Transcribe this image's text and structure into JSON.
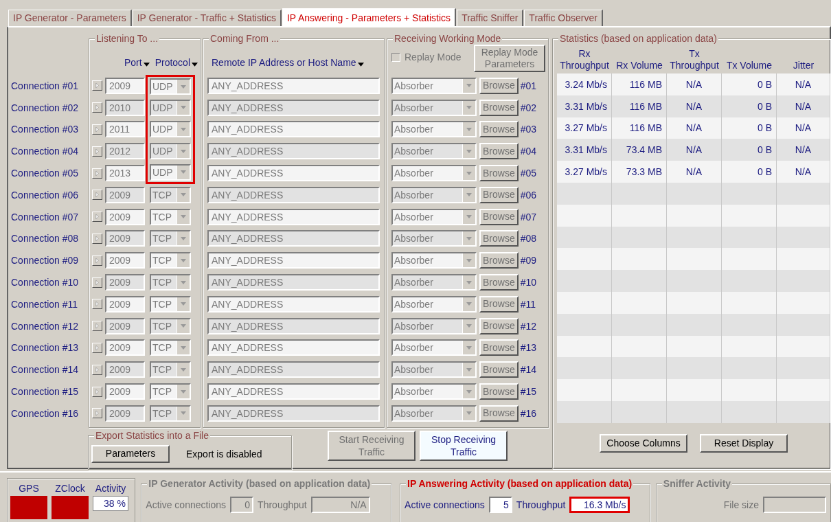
{
  "tabs": [
    {
      "label": "IP Generator - Parameters",
      "selected": false
    },
    {
      "label": "IP Generator - Traffic + Statistics",
      "selected": false
    },
    {
      "label": "IP Answering - Parameters + Statistics",
      "selected": true
    },
    {
      "label": "Traffic Sniffer",
      "selected": false
    },
    {
      "label": "Traffic Observer",
      "selected": false
    }
  ],
  "listening": {
    "legend": "Listening To ...",
    "port_header": "Port",
    "protocol_header": "Protocol"
  },
  "coming_from": {
    "legend": "Coming From ...",
    "header": "Remote IP Address or Host Name"
  },
  "receiving": {
    "legend": "Receiving Working Mode",
    "replay_mode": {
      "label": "Replay Mode",
      "checked": false
    },
    "replay_button": "Replay Mode Parameters"
  },
  "connections": [
    {
      "label": "Connection #01",
      "port": "2009",
      "protocol": "UDP",
      "address": "ANY_ADDRESS",
      "mode": "Absorber",
      "browse": "Browse",
      "index": "#01",
      "highlighted": true
    },
    {
      "label": "Connection #02",
      "port": "2010",
      "protocol": "UDP",
      "address": "ANY_ADDRESS",
      "mode": "Absorber",
      "browse": "Browse",
      "index": "#02",
      "highlighted": true
    },
    {
      "label": "Connection #03",
      "port": "2011",
      "protocol": "UDP",
      "address": "ANY_ADDRESS",
      "mode": "Absorber",
      "browse": "Browse",
      "index": "#03",
      "highlighted": true
    },
    {
      "label": "Connection #04",
      "port": "2012",
      "protocol": "UDP",
      "address": "ANY_ADDRESS",
      "mode": "Absorber",
      "browse": "Browse",
      "index": "#04",
      "highlighted": true
    },
    {
      "label": "Connection #05",
      "port": "2013",
      "protocol": "UDP",
      "address": "ANY_ADDRESS",
      "mode": "Absorber",
      "browse": "Browse",
      "index": "#05",
      "highlighted": true
    },
    {
      "label": "Connection #06",
      "port": "2009",
      "protocol": "TCP",
      "address": "ANY_ADDRESS",
      "mode": "Absorber",
      "browse": "Browse",
      "index": "#06",
      "highlighted": false
    },
    {
      "label": "Connection #07",
      "port": "2009",
      "protocol": "TCP",
      "address": "ANY_ADDRESS",
      "mode": "Absorber",
      "browse": "Browse",
      "index": "#07",
      "highlighted": false
    },
    {
      "label": "Connection #08",
      "port": "2009",
      "protocol": "TCP",
      "address": "ANY_ADDRESS",
      "mode": "Absorber",
      "browse": "Browse",
      "index": "#08",
      "highlighted": false
    },
    {
      "label": "Connection #09",
      "port": "2009",
      "protocol": "TCP",
      "address": "ANY_ADDRESS",
      "mode": "Absorber",
      "browse": "Browse",
      "index": "#09",
      "highlighted": false
    },
    {
      "label": "Connection #10",
      "port": "2009",
      "protocol": "TCP",
      "address": "ANY_ADDRESS",
      "mode": "Absorber",
      "browse": "Browse",
      "index": "#10",
      "highlighted": false
    },
    {
      "label": "Connection #11",
      "port": "2009",
      "protocol": "TCP",
      "address": "ANY_ADDRESS",
      "mode": "Absorber",
      "browse": "Browse",
      "index": "#11",
      "highlighted": false
    },
    {
      "label": "Connection #12",
      "port": "2009",
      "protocol": "TCP",
      "address": "ANY_ADDRESS",
      "mode": "Absorber",
      "browse": "Browse",
      "index": "#12",
      "highlighted": false
    },
    {
      "label": "Connection #13",
      "port": "2009",
      "protocol": "TCP",
      "address": "ANY_ADDRESS",
      "mode": "Absorber",
      "browse": "Browse",
      "index": "#13",
      "highlighted": false
    },
    {
      "label": "Connection #14",
      "port": "2009",
      "protocol": "TCP",
      "address": "ANY_ADDRESS",
      "mode": "Absorber",
      "browse": "Browse",
      "index": "#14",
      "highlighted": false
    },
    {
      "label": "Connection #15",
      "port": "2009",
      "protocol": "TCP",
      "address": "ANY_ADDRESS",
      "mode": "Absorber",
      "browse": "Browse",
      "index": "#15",
      "highlighted": false
    },
    {
      "label": "Connection #16",
      "port": "2009",
      "protocol": "TCP",
      "address": "ANY_ADDRESS",
      "mode": "Absorber",
      "browse": "Browse",
      "index": "#16",
      "highlighted": false
    }
  ],
  "statistics": {
    "legend": "Statistics (based on application data)",
    "columns": [
      "Rx Throughput",
      "Rx Volume",
      "Tx Throughput",
      "Tx Volume",
      "Jitter"
    ],
    "rows": [
      [
        "3.24 Mb/s",
        "116 MB",
        "N/A",
        "0 B",
        "N/A"
      ],
      [
        "3.31 Mb/s",
        "116 MB",
        "N/A",
        "0 B",
        "N/A"
      ],
      [
        "3.27 Mb/s",
        "116 MB",
        "N/A",
        "0 B",
        "N/A"
      ],
      [
        "3.31 Mb/s",
        "73.4 MB",
        "N/A",
        "0 B",
        "N/A"
      ],
      [
        "3.27 Mb/s",
        "73.3 MB",
        "N/A",
        "0 B",
        "N/A"
      ]
    ],
    "choose_columns": "Choose Columns",
    "reset_display": "Reset Display"
  },
  "export": {
    "legend": "Export Statistics into a File",
    "button": "Parameters",
    "status": "Export is disabled"
  },
  "start_button": {
    "label": "Start Receiving Traffic",
    "disabled": true
  },
  "stop_button": {
    "label": "Stop Receiving Traffic",
    "disabled": false
  },
  "indicators": [
    {
      "label": "GPS",
      "color": "#c00000"
    },
    {
      "label": "ZClock",
      "color": "#c00000"
    }
  ],
  "activity": {
    "label": "Activity",
    "value": "38 %"
  },
  "activities": [
    {
      "legend": "IP Generator Activity (based on application data)",
      "disabled": true,
      "highlighted": false,
      "active_label": "Active connections",
      "active_value": "0",
      "throughput_label": "Throughput",
      "throughput_value": "N/A"
    },
    {
      "legend": "IP Answering Activity (based on application data)",
      "disabled": false,
      "highlighted": true,
      "active_label": "Active connections",
      "active_value": "5",
      "throughput_label": "Throughput",
      "throughput_value": "16.3 Mb/s"
    }
  ],
  "sniffer": {
    "legend": "Sniffer Activity",
    "disabled": true,
    "file_size_label": "File size"
  }
}
